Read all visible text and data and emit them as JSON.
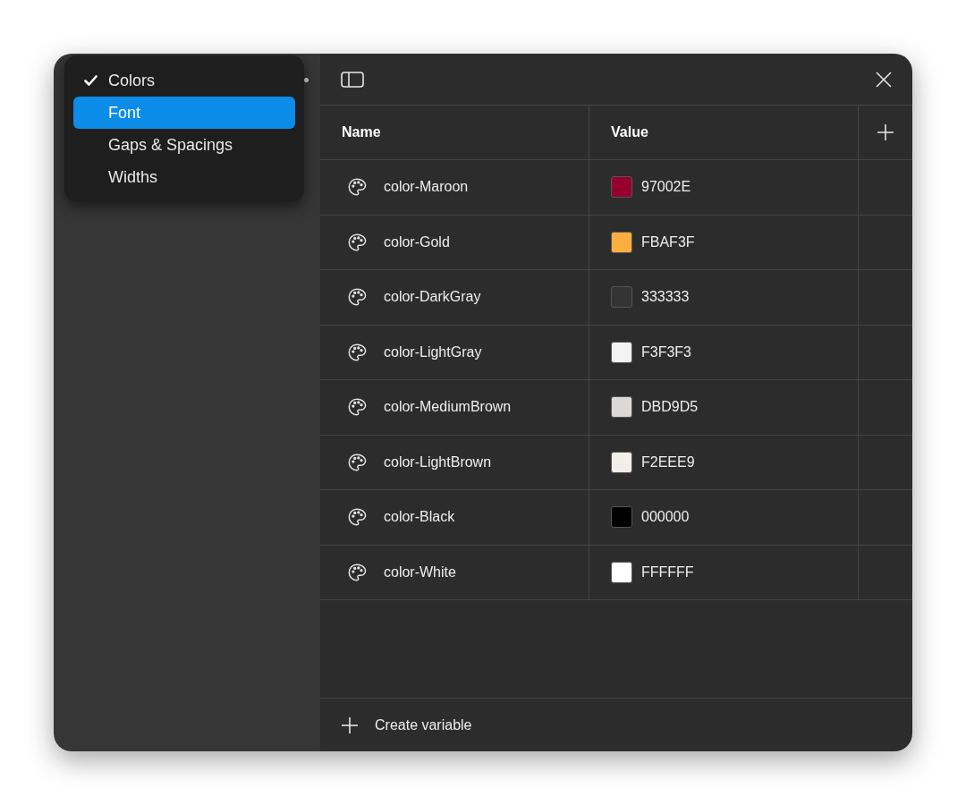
{
  "menu": {
    "items": [
      {
        "label": "Colors",
        "checked": true,
        "selected": false
      },
      {
        "label": "Font",
        "checked": false,
        "selected": true
      },
      {
        "label": "Gaps & Spacings",
        "checked": false,
        "selected": false
      },
      {
        "label": "Widths",
        "checked": false,
        "selected": false
      }
    ]
  },
  "table": {
    "columns": [
      "Name",
      "Value"
    ],
    "rows": [
      {
        "name": "color-Maroon",
        "value": "97002E",
        "color": "#97002e"
      },
      {
        "name": "color-Gold",
        "value": "FBAF3F",
        "color": "#fbaf3f"
      },
      {
        "name": "color-DarkGray",
        "value": "333333",
        "color": "#333333"
      },
      {
        "name": "color-LightGray",
        "value": "F3F3F3",
        "color": "#f3f3f3"
      },
      {
        "name": "color-MediumBrown",
        "value": "DBD9D5",
        "color": "#dbd9d5"
      },
      {
        "name": "color-LightBrown",
        "value": "F2EEE9",
        "color": "#f2eee9"
      },
      {
        "name": "color-Black",
        "value": "000000",
        "color": "#000000"
      },
      {
        "name": "color-White",
        "value": "FFFFFF",
        "color": "#ffffff"
      }
    ]
  },
  "footer": {
    "create_label": "Create variable"
  }
}
